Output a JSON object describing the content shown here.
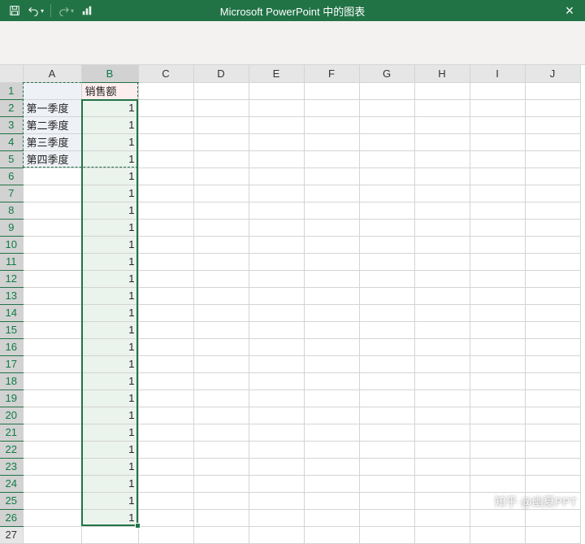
{
  "window": {
    "title": "Microsoft PowerPoint 中的图表",
    "close_glyph": "×"
  },
  "qat": {
    "save": "💾",
    "undo": "↶",
    "redo": "↷",
    "chart": "⊞"
  },
  "columns": [
    "A",
    "B",
    "C",
    "D",
    "E",
    "F",
    "G",
    "H",
    "I",
    "J"
  ],
  "rows": 26,
  "cells": {
    "B1": "销售额",
    "A2": "第一季度",
    "A3": "第二季度",
    "A4": "第三季度",
    "A5": "第四季度",
    "B2": "1",
    "B3": "1",
    "B4": "1",
    "B5": "1",
    "B6": "1",
    "B7": "1",
    "B8": "1",
    "B9": "1",
    "B10": "1",
    "B11": "1",
    "B12": "1",
    "B13": "1",
    "B14": "1",
    "B15": "1",
    "B16": "1",
    "B17": "1",
    "B18": "1",
    "B19": "1",
    "B20": "1",
    "B21": "1",
    "B22": "1",
    "B23": "1",
    "B24": "1",
    "B25": "1",
    "B26": "1"
  },
  "watermark": "知乎 @幽夏PPT",
  "chart_data": {
    "type": "bar",
    "title": "",
    "categories": [
      "第一季度",
      "第二季度",
      "第三季度",
      "第四季度"
    ],
    "series": [
      {
        "name": "销售额",
        "values": [
          1,
          1,
          1,
          1
        ]
      }
    ],
    "xlabel": "",
    "ylabel": "",
    "ylim": [
      0,
      1
    ]
  }
}
